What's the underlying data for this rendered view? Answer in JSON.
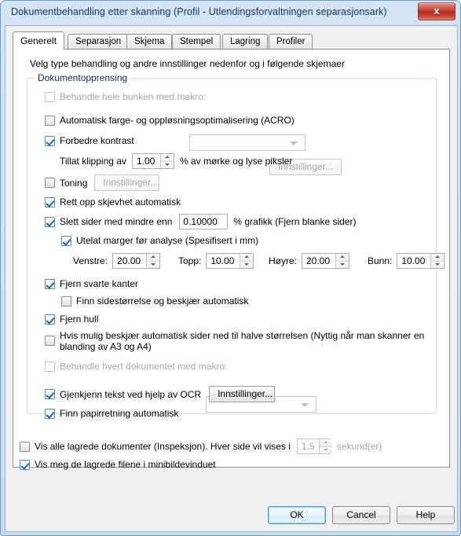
{
  "window": {
    "title": "Dokumentbehandling etter skanning (Profil - Utlendingsforvaltningen separasjonsark)",
    "close_label": "x"
  },
  "tabs": [
    {
      "label": "Generelt",
      "active": true
    },
    {
      "label": "Separasjon",
      "active": false
    },
    {
      "label": "Skjema",
      "active": false
    },
    {
      "label": "Stempel",
      "active": false
    },
    {
      "label": "Lagring",
      "active": false
    },
    {
      "label": "Profiler",
      "active": false
    }
  ],
  "page": {
    "hint": "Velg type behandling og andre innstillinger nedenfor og i følgende skjemaer",
    "group_title": "Dokumentopprensing"
  },
  "controls": {
    "macro_batch": {
      "label": "Behandle hele bunken med makro:",
      "checked": false,
      "enabled": false,
      "combo_value": ""
    },
    "acro": {
      "label": "Automatisk farge- og oppløsningsoptimalisering (ACRO)",
      "checked": false,
      "enabled": true,
      "settings_label": "Innstillinger...",
      "settings_enabled": false
    },
    "contrast": {
      "label": "Forbedre kontrast",
      "checked": true
    },
    "clipping": {
      "prefix": "Tillat klipping av",
      "value": "1.00",
      "suffix": "% av mørke og lyse piksler"
    },
    "toning": {
      "label": "Toning",
      "checked": false,
      "settings_label": "Innstillinger...",
      "settings_enabled": false
    },
    "deskew": {
      "label": "Rett opp skjevhet automatisk",
      "checked": true
    },
    "delete_blank": {
      "label": "Slett sider med mindre enn",
      "checked": true,
      "value": "0.10000",
      "suffix": "% grafikk (Fjern blanke sider)"
    },
    "ignore_margins": {
      "label": "Utelat marger før analyse (Spesifisert i mm)",
      "checked": true
    },
    "margins": [
      {
        "label": "Venstre:",
        "value": "20.00"
      },
      {
        "label": "Topp:",
        "value": "10.00"
      },
      {
        "label": "Høyre:",
        "value": "20.00"
      },
      {
        "label": "Bunn:",
        "value": "10.00"
      }
    ],
    "remove_black_edges": {
      "label": "Fjern svarte kanter",
      "checked": true
    },
    "auto_page_size": {
      "label": "Finn sidestørrelse og beskjær automatisk",
      "checked": false
    },
    "remove_holes": {
      "label": "Fjern hull",
      "checked": true
    },
    "half_size_crop": {
      "label": "Hvis mulig beskjær automatisk sider ned til halve størrelsen (Nyttig når man skanner en blanding av A3 og A4)",
      "checked": false
    },
    "macro_each_doc": {
      "label": "Behandle hvert dokumentet med makro:",
      "checked": false,
      "enabled": false,
      "combo_value": ""
    },
    "ocr": {
      "label": "Gjenkjenn tekst ved hjelp av OCR",
      "checked": true,
      "settings_label": "Innstillinger...",
      "settings_enabled": true
    },
    "paper_orientation": {
      "label": "Finn papirretning automatisk",
      "checked": true
    },
    "inspection": {
      "label": "Vis alle lagrede dokumenter (Inspeksjon). Hver side vil vises i",
      "checked": false,
      "value": "1.5",
      "suffix": "sekund(er)"
    },
    "show_thumbnails": {
      "label": "Vis meg de lagrede filene i minibildevinduet",
      "checked": true
    }
  },
  "footer": {
    "ok": "OK",
    "cancel": "Cancel",
    "help": "Help"
  }
}
